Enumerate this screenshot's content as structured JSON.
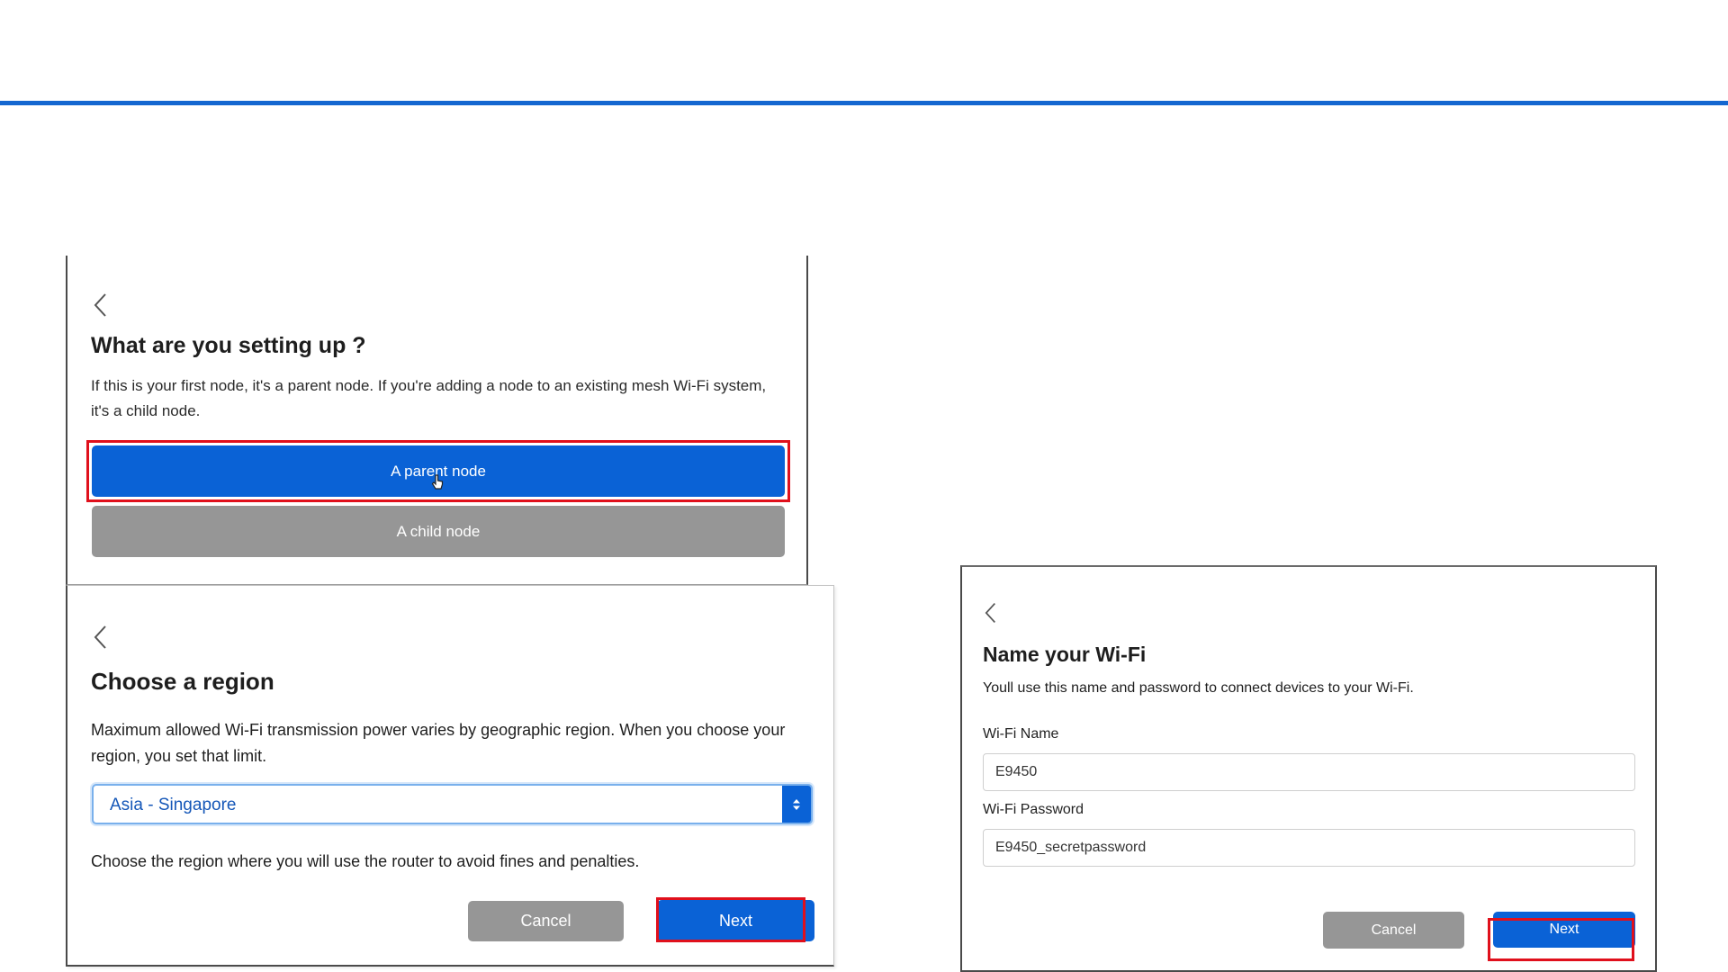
{
  "setup_panel": {
    "title": "What are you setting up ?",
    "description": "If this is your first node, it's a parent node. If you're adding a node to an existing mesh Wi-Fi system, it's a child node.",
    "parent_button": "A parent node",
    "child_button": "A child node",
    "back_icon": "chevron-left-icon",
    "cursor_icon": "hand-pointer-icon"
  },
  "region_panel": {
    "title": "Choose a region",
    "description": "Maximum allowed Wi-Fi transmission power varies by geographic region. When you choose your region, you set that limit.",
    "region_selected": "Asia - Singapore",
    "note": "Choose the region where you will use the router to avoid fines and penalties.",
    "cancel_button": "Cancel",
    "next_button": "Next",
    "back_icon": "chevron-left-icon"
  },
  "wifi_panel": {
    "title": "Name your Wi-Fi",
    "description": "Youll use this name and password to connect devices to your Wi-Fi.",
    "name_label": "Wi-Fi Name",
    "name_value": "E9450",
    "password_label": "Wi-Fi Password",
    "password_value": "E9450_secretpassword",
    "cancel_button": "Cancel",
    "next_button": "Next",
    "back_icon": "chevron-left-icon"
  },
  "colors": {
    "accent_blue": "#0a62d6",
    "top_rule": "#1467d0",
    "highlight_red": "#e0101c",
    "button_gray": "#969696"
  }
}
